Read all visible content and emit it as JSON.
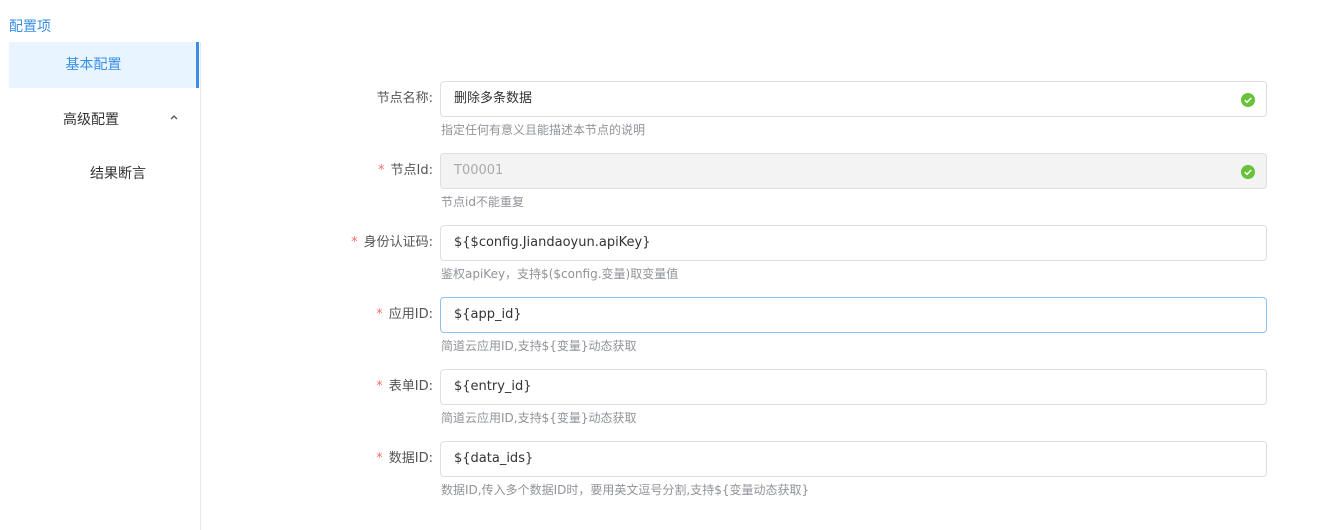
{
  "panel": {
    "title": "配置项"
  },
  "sidebar": {
    "items": [
      {
        "label": "基本配置"
      },
      {
        "label": "高级配置"
      },
      {
        "label": "结果断言"
      }
    ]
  },
  "form": {
    "fields": [
      {
        "label": "节点名称:",
        "value": "删除多条数据",
        "hint": "指定任何有意义且能描述本节点的说明"
      },
      {
        "required_mark": "*",
        "label": "节点Id:",
        "value": "T00001",
        "hint": "节点id不能重复"
      },
      {
        "required_mark": "*",
        "label": "身份认证码:",
        "value": "${$config.Jiandaoyun.apiKey}",
        "hint": "鉴权apiKey，支持$($config.变量)取变量值"
      },
      {
        "required_mark": "*",
        "label": "应用ID:",
        "value": "${app_id}",
        "hint": "简道云应用ID,支持${变量}动态获取"
      },
      {
        "required_mark": "*",
        "label": "表单ID:",
        "value": "${entry_id}",
        "hint": "简道云应用ID,支持${变量}动态获取"
      },
      {
        "required_mark": "*",
        "label": "数据ID:",
        "value": "${data_ids}",
        "hint": "数据ID,传入多个数据ID时，要用英文逗号分割,支持${变量动态获取}"
      }
    ]
  },
  "colors": {
    "accent": "#3a8ee6",
    "success": "#67c23a",
    "required": "#f56c6c"
  }
}
